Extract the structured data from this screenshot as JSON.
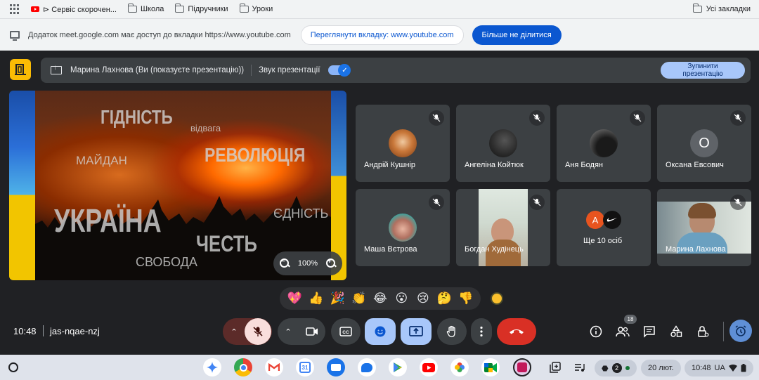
{
  "bookmarks": {
    "items": [
      {
        "label": "⊳ Сервіс скорочен...",
        "icon": "youtube-icon"
      },
      {
        "label": "Школа",
        "icon": "folder-icon"
      },
      {
        "label": "Підручники",
        "icon": "folder-icon"
      },
      {
        "label": "Уроки",
        "icon": "folder-icon"
      }
    ],
    "all_bookmarks": "Усі закладки"
  },
  "share_bar": {
    "message": "Додаток meet.google.com має доступ до вкладки https://www.youtube.com",
    "switch_label": "Переглянути вкладку: www.youtube.com",
    "stop_label": "Більше не ділитися"
  },
  "meet_top": {
    "presenter_text": "Марина Лахнова (Ви (показуєте презентацію))",
    "audio_label": "Звук презентації",
    "stop_line1": "Зупинити",
    "stop_line2": "презентацію"
  },
  "slide": {
    "words": [
      "ГІДНІСТЬ",
      "відвага",
      "МАЙДАН",
      "РЕВОЛЮЦІЯ",
      "УКРАЇНА",
      "ЄДНІСТЬ",
      "ЧЕСТЬ",
      "СВОБОДА"
    ],
    "zoom": "100%"
  },
  "participants": [
    {
      "name": "Андрій Кушнір",
      "avatar": "photo"
    },
    {
      "name": "Ангеліна Койтюк",
      "avatar": "photo"
    },
    {
      "name": "Аня Бодян",
      "avatar": "photo"
    },
    {
      "name": "Оксана Евсович",
      "avatar": "О"
    },
    {
      "name": "Маша Вєтрова",
      "avatar": "photo"
    },
    {
      "name": "Богдан Худінець",
      "avatar": "video"
    },
    {
      "name": "Ще 10 осіб",
      "avatar": "А"
    },
    {
      "name": "Марина Лахнова",
      "avatar": "video"
    }
  ],
  "reactions": [
    "💖",
    "👍",
    "🎉",
    "👏",
    "😂",
    "😮",
    "😢",
    "🤔",
    "👎"
  ],
  "controls": {
    "time": "10:48",
    "meeting_code": "jas-nqae-nzj",
    "people_count": "18"
  },
  "taskbar": {
    "date": "20 лют.",
    "clock": "10:48",
    "locale": "UA",
    "notif_count": "2"
  },
  "colors": {
    "meet_bg": "#202124",
    "tile_bg": "#3c4043",
    "accent_blue": "#a8c7fa",
    "hangup_red": "#d93025",
    "chrome_blue": "#0b57d0"
  }
}
